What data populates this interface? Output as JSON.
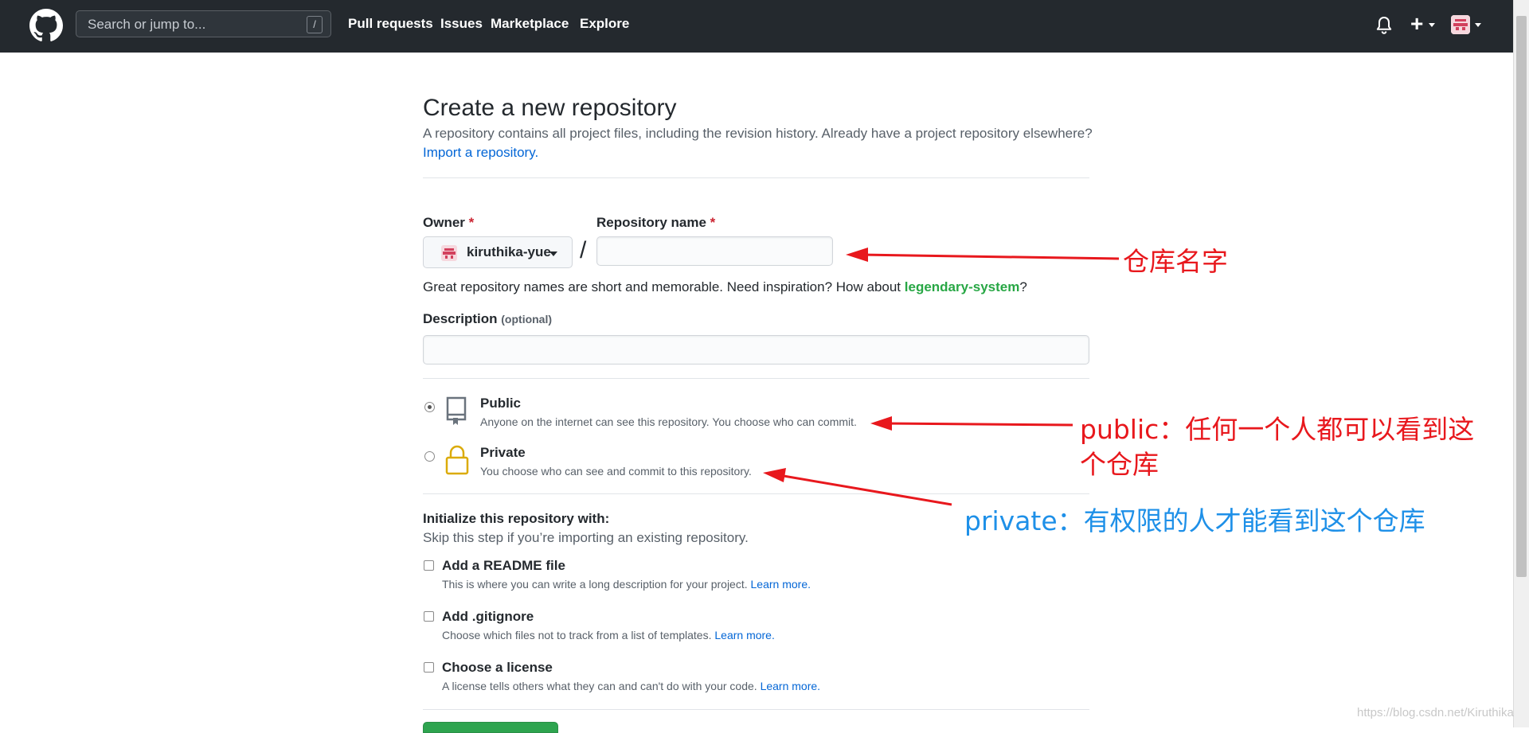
{
  "header": {
    "search_placeholder": "Search or jump to...",
    "search_shortcut": "/",
    "nav": [
      "Pull requests",
      "Issues",
      "Marketplace",
      "Explore"
    ],
    "plus_label": "+"
  },
  "form": {
    "title": "Create a new repository",
    "subtitle": "A repository contains all project files, including the revision history. Already have a project repository elsewhere?",
    "import_link": "Import a repository.",
    "owner_label": "Owner",
    "required_mark": "*",
    "owner_value": "kiruthika-yue",
    "separator": "/",
    "repo_name_label": "Repository name",
    "repo_name_value": "",
    "hint_prefix": "Great repository names are short and memorable. Need inspiration? How about ",
    "hint_suggestion": "legendary-system",
    "hint_suffix": "?",
    "description_label": "Description",
    "description_optional": "(optional)",
    "description_value": "",
    "visibility": [
      {
        "title": "Public",
        "desc": "Anyone on the internet can see this repository. You choose who can commit.",
        "checked": true
      },
      {
        "title": "Private",
        "desc": "You choose who can see and commit to this repository.",
        "checked": false
      }
    ],
    "init_title": "Initialize this repository with:",
    "init_sub": "Skip this step if you’re importing an existing repository.",
    "init_options": [
      {
        "title": "Add a README file",
        "desc": "This is where you can write a long description for your project.",
        "link": "Learn more."
      },
      {
        "title": "Add .gitignore",
        "desc": "Choose which files not to track from a list of templates.",
        "link": "Learn more."
      },
      {
        "title": "Choose a license",
        "desc": "A license tells others what they can and can't do with your code.",
        "link": "Learn more."
      }
    ]
  },
  "annotations": {
    "repo_name_note": "仓库名字",
    "public_note_line1": "public：任何一个人都可以看到这",
    "public_note_line2": "个仓库",
    "private_note": "private：有权限的人才能看到这个仓库",
    "red": "#e8181d",
    "blue": "#1e90e8"
  },
  "watermark": "https://blog.csdn.net/Kiruthika"
}
